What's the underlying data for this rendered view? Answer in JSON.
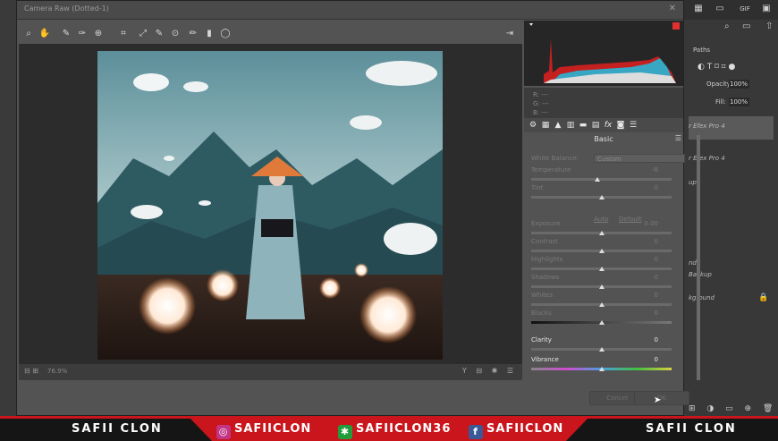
{
  "window": {
    "title": "Camera Raw (Dotted-1)",
    "close": "✕"
  },
  "tools": [
    "zoom-icon",
    "hand-icon",
    "white-balance-icon",
    "color-sampler-icon",
    "targeted-adjust-icon",
    "crop-icon",
    "straighten-icon",
    "spot-removal-icon",
    "red-eye-icon",
    "adjustment-brush-icon",
    "graduated-filter-icon",
    "radial-filter-icon"
  ],
  "preview": {
    "zoom": "76.9%"
  },
  "rgb": {
    "r": "R:  ---",
    "g": "G:  ---",
    "b": "B:  ---"
  },
  "panel": {
    "title": "Basic",
    "white_balance_label": "White Balance:",
    "white_balance_value": "Custom",
    "auto": "Auto",
    "default": "Default",
    "sliders": [
      {
        "label": "Temperature",
        "value": "-8",
        "pos": 0.47,
        "active": false
      },
      {
        "label": "Tint",
        "value": "0",
        "pos": 0.5,
        "active": false
      },
      {
        "label": "Exposure",
        "value": "0.00",
        "pos": 0.5,
        "active": false
      },
      {
        "label": "Contrast",
        "value": "0",
        "pos": 0.5,
        "active": false
      },
      {
        "label": "Highlights",
        "value": "0",
        "pos": 0.5,
        "active": false
      },
      {
        "label": "Shadows",
        "value": "0",
        "pos": 0.5,
        "active": false
      },
      {
        "label": "Whites",
        "value": "0",
        "pos": 0.5,
        "active": false
      },
      {
        "label": "Blacks",
        "value": "0",
        "pos": 0.5,
        "active": false
      },
      {
        "label": "Clarity",
        "value": "0",
        "pos": 0.5,
        "active": true
      },
      {
        "label": "Vibrance",
        "value": "0",
        "pos": 0.5,
        "active": true
      }
    ]
  },
  "buttons": {
    "cancel": "Cancel",
    "ok": "OK"
  },
  "photoshop": {
    "paths": "Paths",
    "opacity_label": "Opacity:",
    "opacity": "100%",
    "fill_label": "Fill:",
    "fill": "100%",
    "layers": [
      "r Efex Pro 4",
      "r Efex Pro 4",
      "up",
      "nd",
      "Backup",
      "kground"
    ]
  },
  "banner": {
    "left": "SAFII CLON",
    "instagram": "SAFIICLON",
    "other": "SAFIICLON36",
    "facebook": "SAFIICLON",
    "right": "SAFII CLON"
  },
  "colors": {
    "accent_red": "#c9151b"
  }
}
